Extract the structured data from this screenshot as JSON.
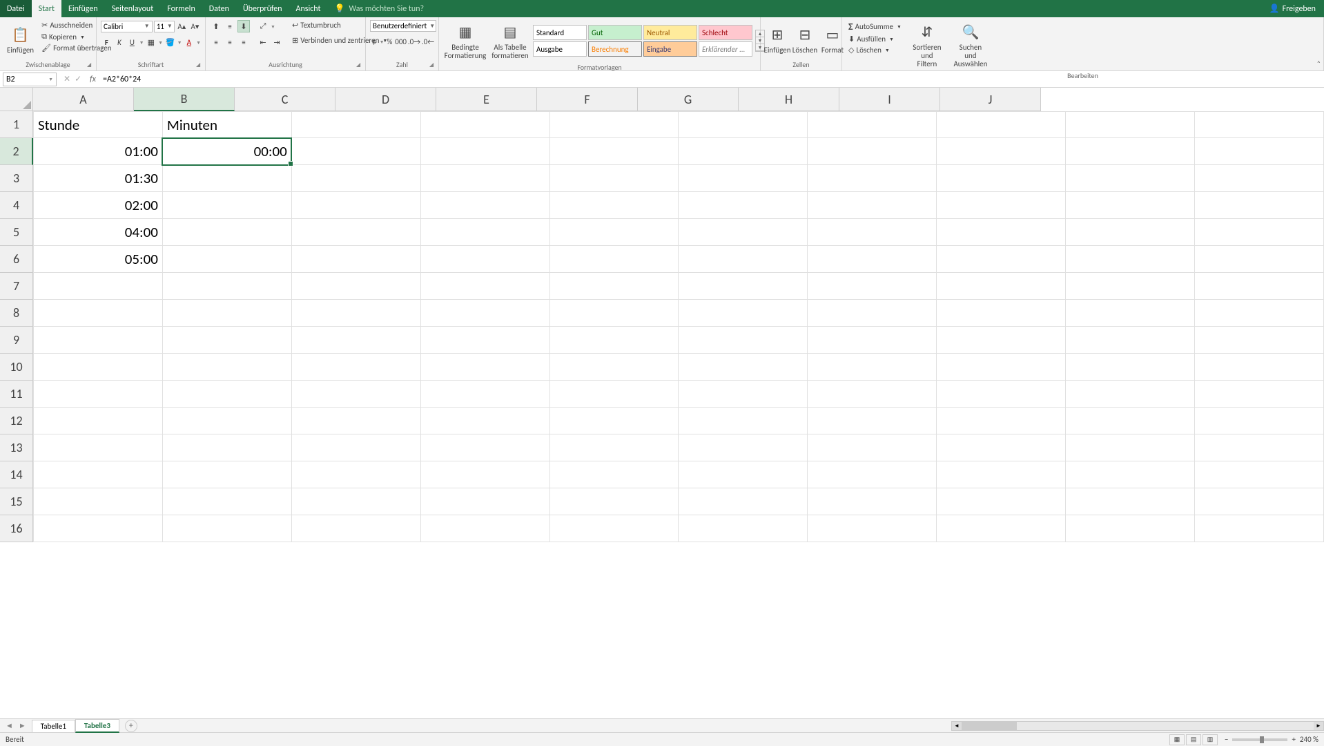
{
  "tabs": {
    "file": "Datei",
    "start": "Start",
    "insert": "Einfügen",
    "pagelayout": "Seitenlayout",
    "formulas": "Formeln",
    "data": "Daten",
    "review": "Überprüfen",
    "view": "Ansicht",
    "tellme": "Was möchten Sie tun?",
    "share": "Freigeben"
  },
  "ribbon": {
    "clipboard": {
      "paste": "Einfügen",
      "cut": "Ausschneiden",
      "copy": "Kopieren",
      "format_painter": "Format übertragen",
      "label": "Zwischenablage"
    },
    "font": {
      "name": "Calibri",
      "size": "11",
      "label": "Schriftart"
    },
    "alignment": {
      "wrap": "Textumbruch",
      "merge": "Verbinden und zentrieren",
      "label": "Ausrichtung"
    },
    "number": {
      "format": "Benutzerdefiniert",
      "label": "Zahl"
    },
    "styles": {
      "conditional": "Bedingte\nFormatierung",
      "as_table": "Als Tabelle\nformatieren",
      "s_standard": "Standard",
      "s_gut": "Gut",
      "s_neutral": "Neutral",
      "s_schlecht": "Schlecht",
      "s_ausgabe": "Ausgabe",
      "s_berechnung": "Berechnung",
      "s_eingabe": "Eingabe",
      "s_erkl": "Erklärender ...",
      "label": "Formatvorlagen"
    },
    "cells": {
      "insert": "Einfügen",
      "delete": "Löschen",
      "format": "Format",
      "label": "Zellen"
    },
    "editing": {
      "autosum": "AutoSumme",
      "fill": "Ausfüllen",
      "clear": "Löschen",
      "sort": "Sortieren und\nFiltern",
      "find": "Suchen und\nAuswählen",
      "label": "Bearbeiten"
    }
  },
  "namebox": "B2",
  "formula": "=A2*60*24",
  "columns": [
    "A",
    "B",
    "C",
    "D",
    "E",
    "F",
    "G",
    "H",
    "I",
    "J"
  ],
  "selected_col_idx": 1,
  "selected_row_idx": 1,
  "row_count": 16,
  "cells": {
    "r1": {
      "a": "Stunde",
      "b": "Minuten"
    },
    "r2": {
      "a": "01:00",
      "b": "00:00"
    },
    "r3": {
      "a": "01:30"
    },
    "r4": {
      "a": "02:00"
    },
    "r5": {
      "a": "04:00"
    },
    "r6": {
      "a": "05:00"
    }
  },
  "sheets": {
    "tab1": "Tabelle1",
    "tab3": "Tabelle3"
  },
  "status": {
    "ready": "Bereit",
    "zoom": "240 %"
  }
}
